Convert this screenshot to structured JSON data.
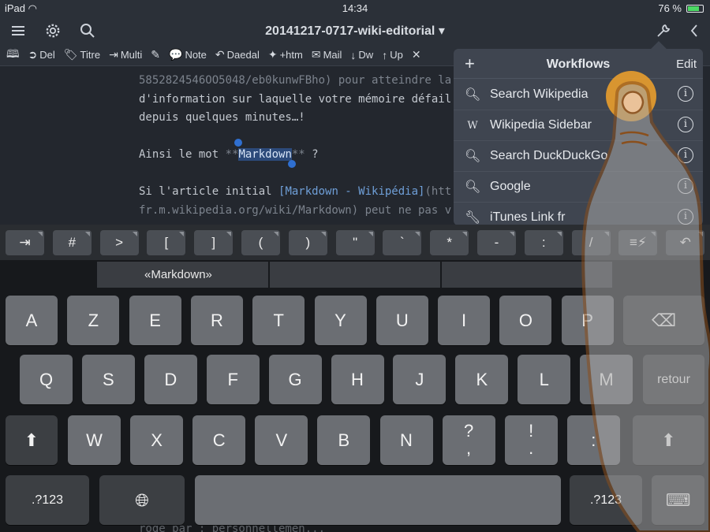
{
  "status": {
    "device": "iPad",
    "time": "14:34",
    "battery": "76 %",
    "battery_level": 0.76
  },
  "nav": {
    "title": "20141217-0717-wiki-editorial ▾"
  },
  "toolbar": {
    "items": [
      {
        "icon": "book-icon",
        "glyph": "🕮",
        "label": ""
      },
      {
        "icon": "arrow-circle-icon",
        "glyph": "➲",
        "label": "Del"
      },
      {
        "icon": "tag-icon",
        "glyph": "🏷",
        "label": "Titre"
      },
      {
        "icon": "export-icon",
        "glyph": "⇥",
        "label": "Multi"
      },
      {
        "icon": "edit-icon",
        "glyph": "✎",
        "label": ""
      },
      {
        "icon": "speech-bubble-icon",
        "glyph": "💬",
        "label": "Note"
      },
      {
        "icon": "reply-icon",
        "glyph": "↶",
        "label": "Daedal"
      },
      {
        "icon": "pin-icon",
        "glyph": "✦",
        "label": "+htm"
      },
      {
        "icon": "envelope-icon",
        "glyph": "✉",
        "label": "Mail"
      },
      {
        "icon": "arrow-down-icon",
        "glyph": "↓",
        "label": "Dw"
      },
      {
        "icon": "arrow-up-icon",
        "glyph": "↑",
        "label": "Up"
      },
      {
        "icon": "cross-icon",
        "glyph": "✕",
        "label": ""
      }
    ]
  },
  "editor": {
    "l1": "5852824546OO5048/eb0kunwFBho) pour atteindre la",
    "l2": "d'information sur laquelle votre mémoire défail",
    "l3": "depuis quelques minutes…!",
    "l4_pre": "Ainsi le mot ",
    "l4_marks": "**",
    "l4_sel": "Markdown",
    "l4_post": " ?",
    "l5_pre": "Si l'article initial ",
    "l5_link": "[Markdown - Wikipédia]",
    "l5_post": "(htt",
    "l6": "fr.m.wikipedia.org/wiki/Markdown) peut ne pas v"
  },
  "workflows": {
    "title": "Workflows",
    "edit": "Edit",
    "items": [
      {
        "label": "Search Wikipedia",
        "icon": "search-icon"
      },
      {
        "label": "Wikipedia Sidebar",
        "icon": "wikipedia-icon"
      },
      {
        "label": "Search DuckDuckGo",
        "icon": "search-icon"
      },
      {
        "label": "Google",
        "icon": "search-icon"
      },
      {
        "label": "iTunes Link fr",
        "icon": "wrench-icon"
      }
    ]
  },
  "accessory": {
    "keys": [
      "⇥",
      "#",
      ">",
      "[",
      "]",
      "(",
      ")",
      "\"",
      "`",
      "*",
      "-",
      ":",
      "/",
      "≡⚡",
      "↶"
    ]
  },
  "suggestion": "«Markdown»",
  "keyboard": {
    "row1": [
      "A",
      "Z",
      "E",
      "R",
      "T",
      "Y",
      "U",
      "I",
      "O",
      "P"
    ],
    "row2": [
      "Q",
      "S",
      "D",
      "F",
      "G",
      "H",
      "J",
      "K",
      "L",
      "M"
    ],
    "row3": [
      "W",
      "X",
      "C",
      "V",
      "B",
      "N",
      "?\n,",
      "!\n.",
      ":"
    ],
    "return": "retour",
    "num_left": ".?123",
    "num_right": ".?123"
  },
  "bg_hint": "rode par : personnellemen..."
}
